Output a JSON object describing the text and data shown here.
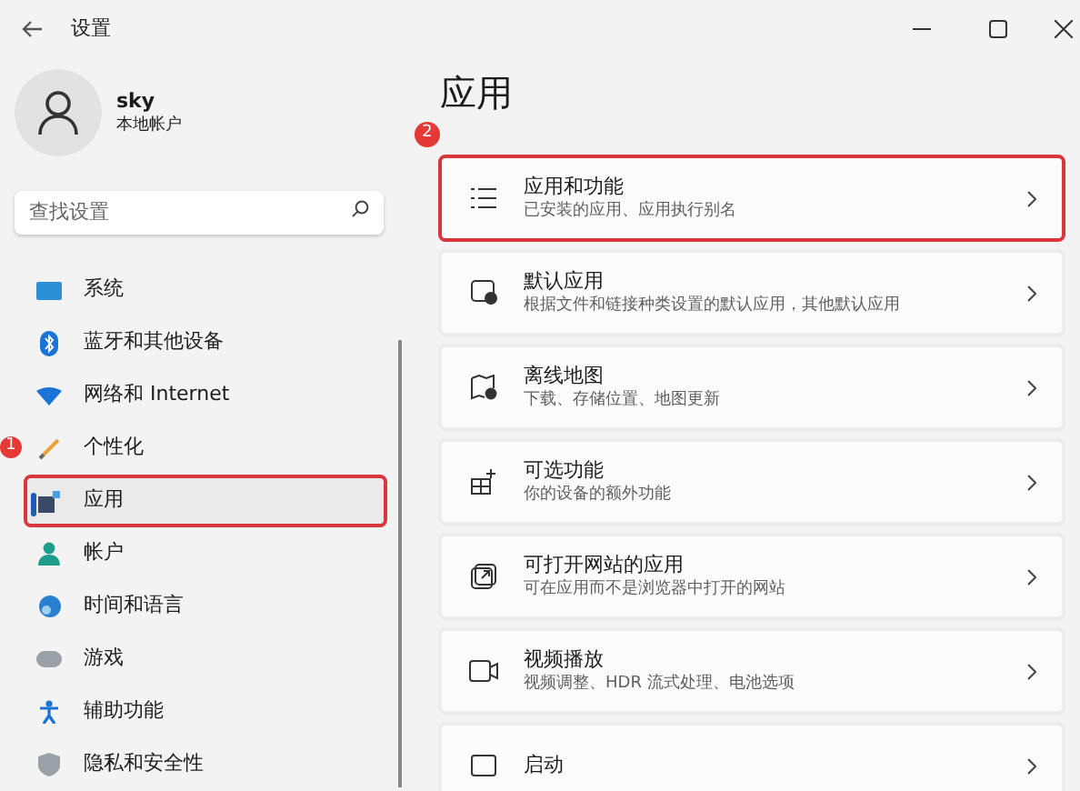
{
  "window": {
    "title": "设置"
  },
  "profile": {
    "name": "sky",
    "account_type": "本地帐户"
  },
  "search": {
    "placeholder": "查找设置"
  },
  "sidebar": {
    "items": [
      {
        "label": "系统",
        "selected": false,
        "highlighted": false
      },
      {
        "label": "蓝牙和其他设备",
        "selected": false,
        "highlighted": false
      },
      {
        "label": "网络和 Internet",
        "selected": false,
        "highlighted": false
      },
      {
        "label": "个性化",
        "selected": false,
        "highlighted": false,
        "badge": "1"
      },
      {
        "label": "应用",
        "selected": true,
        "highlighted": true
      },
      {
        "label": "帐户",
        "selected": false,
        "highlighted": false
      },
      {
        "label": "时间和语言",
        "selected": false,
        "highlighted": false
      },
      {
        "label": "游戏",
        "selected": false,
        "highlighted": false
      },
      {
        "label": "辅助功能",
        "selected": false,
        "highlighted": false
      },
      {
        "label": "隐私和安全性",
        "selected": false,
        "highlighted": false
      }
    ]
  },
  "page": {
    "title": "应用",
    "badge": "2"
  },
  "cards": [
    {
      "title": "应用和功能",
      "subtitle": "已安装的应用、应用执行别名",
      "highlighted": true
    },
    {
      "title": "默认应用",
      "subtitle": "根据文件和链接种类设置的默认应用，其他默认应用",
      "highlighted": false
    },
    {
      "title": "离线地图",
      "subtitle": "下载、存储位置、地图更新",
      "highlighted": false
    },
    {
      "title": "可选功能",
      "subtitle": "你的设备的额外功能",
      "highlighted": false
    },
    {
      "title": "可打开网站的应用",
      "subtitle": "可在应用而不是浏览器中打开的网站",
      "highlighted": false
    },
    {
      "title": "视频播放",
      "subtitle": "视频调整、HDR 流式处理、电池选项",
      "highlighted": false
    },
    {
      "title": "启动",
      "highlighted": false
    }
  ]
}
